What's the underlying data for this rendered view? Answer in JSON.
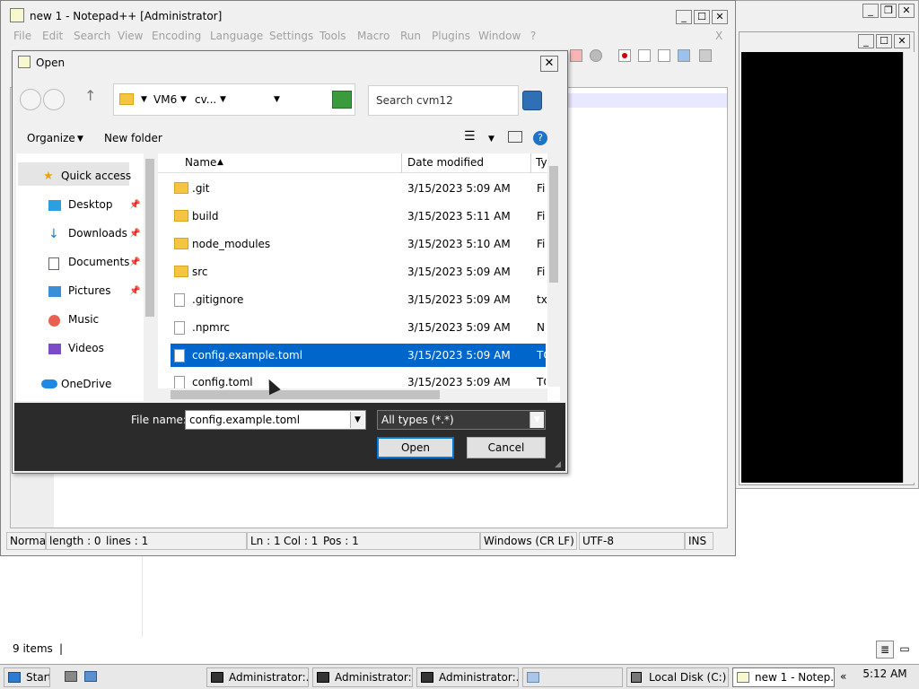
{
  "explorer_bg": {
    "status": "9 items",
    "status_sep": "|"
  },
  "npp": {
    "title": "new 1 - Notepad++ [Administrator]",
    "window_controls": [
      "_",
      "☐",
      "✕"
    ],
    "menu": [
      "File",
      "Edit",
      "Search",
      "View",
      "Encoding",
      "Language",
      "Settings",
      "Tools",
      "Macro",
      "Run",
      "Plugins",
      "Window",
      "?"
    ],
    "menu_close": "X",
    "status": {
      "type": "Normal",
      "length": "length : 0",
      "lines": "lines : 1",
      "ln": "Ln : 1",
      "col": "Col : 1",
      "pos": "Pos : 1",
      "eol": "Windows (CR LF)",
      "encoding": "UTF-8",
      "mode": "INS"
    }
  },
  "dialog": {
    "title": "Open",
    "close": "✕",
    "breadcrumb": [
      "VM6",
      "cv..."
    ],
    "search_placeholder": "Search cvm12",
    "organize": "Organize",
    "new_folder": "New folder",
    "nav": [
      {
        "label": "Quick access",
        "icon": "star-icon"
      },
      {
        "label": "Desktop",
        "icon": "desktop-icon",
        "pinned": true
      },
      {
        "label": "Downloads",
        "icon": "download-icon",
        "pinned": true
      },
      {
        "label": "Documents",
        "icon": "document-icon",
        "pinned": true
      },
      {
        "label": "Pictures",
        "icon": "picture-icon",
        "pinned": true
      },
      {
        "label": "Music",
        "icon": "music-icon"
      },
      {
        "label": "Videos",
        "icon": "video-icon"
      },
      {
        "label": "OneDrive",
        "icon": "cloud-icon"
      }
    ],
    "columns": {
      "name": "Name",
      "date": "Date modified",
      "type": "Ty"
    },
    "files": [
      {
        "name": ".git",
        "date": "3/15/2023 5:09 AM",
        "type": "Fi",
        "kind": "folder"
      },
      {
        "name": "build",
        "date": "3/15/2023 5:11 AM",
        "type": "Fi",
        "kind": "folder"
      },
      {
        "name": "node_modules",
        "date": "3/15/2023 5:10 AM",
        "type": "Fi",
        "kind": "folder"
      },
      {
        "name": "src",
        "date": "3/15/2023 5:09 AM",
        "type": "Fi",
        "kind": "folder"
      },
      {
        "name": ".gitignore",
        "date": "3/15/2023 5:09 AM",
        "type": "tx",
        "kind": "file"
      },
      {
        "name": ".npmrc",
        "date": "3/15/2023 5:09 AM",
        "type": "N",
        "kind": "file"
      },
      {
        "name": "config.example.toml",
        "date": "3/15/2023 5:09 AM",
        "type": "TO",
        "kind": "file",
        "selected": true
      },
      {
        "name": "config.toml",
        "date": "3/15/2023 5:09 AM",
        "type": "TO",
        "kind": "file"
      }
    ],
    "file_name_label": "File name:",
    "file_name_value": "config.example.toml",
    "file_type": "All types (*.*)",
    "open_button": "Open",
    "cancel_button": "Cancel"
  },
  "taskbar": {
    "start": "Start",
    "items": [
      "Administrator:...",
      "Administrator:...",
      "Administrator:..."
    ],
    "local_disk": "Local Disk (C:)",
    "npp_item": "new 1 - Notep...",
    "chevron": "«",
    "clock": "5:12 AM"
  }
}
